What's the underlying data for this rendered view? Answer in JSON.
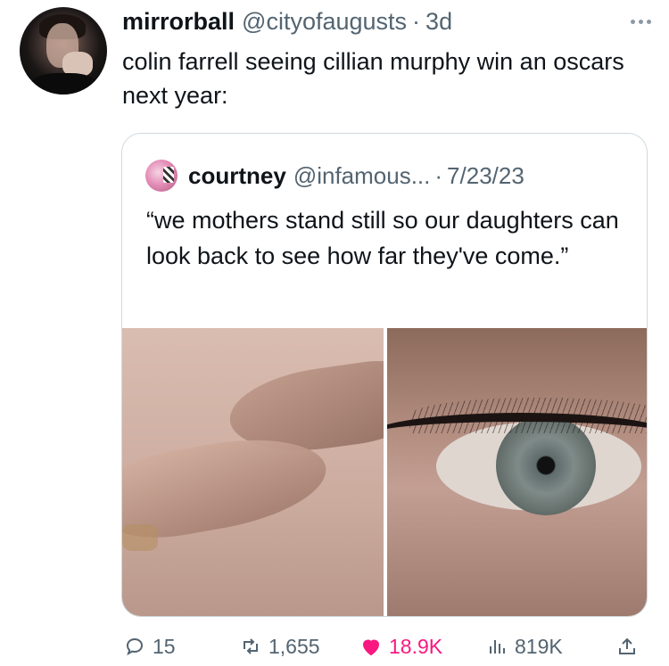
{
  "tweet": {
    "author_name": "mirrorball",
    "author_handle": "@cityofaugusts",
    "separator": "·",
    "time": "3d",
    "text": "colin farrell seeing cillian murphy win an oscars next year:"
  },
  "quote": {
    "author_name": "courtney",
    "author_handle": "@infamous...",
    "separator": "·",
    "date": "7/23/23",
    "text": "“we mothers stand still so our daughters can look back to see how far they've come.”"
  },
  "actions": {
    "replies": "15",
    "retweets": "1,655",
    "likes": "18.9K",
    "views": "819K"
  },
  "icons": {
    "more": "more-icon",
    "reply": "reply-icon",
    "retweet": "retweet-icon",
    "like": "heart-icon",
    "views": "views-icon",
    "share": "share-icon"
  },
  "colors": {
    "like_accent": "#f91880",
    "secondary_text": "#536471",
    "border": "#cfd9de"
  }
}
